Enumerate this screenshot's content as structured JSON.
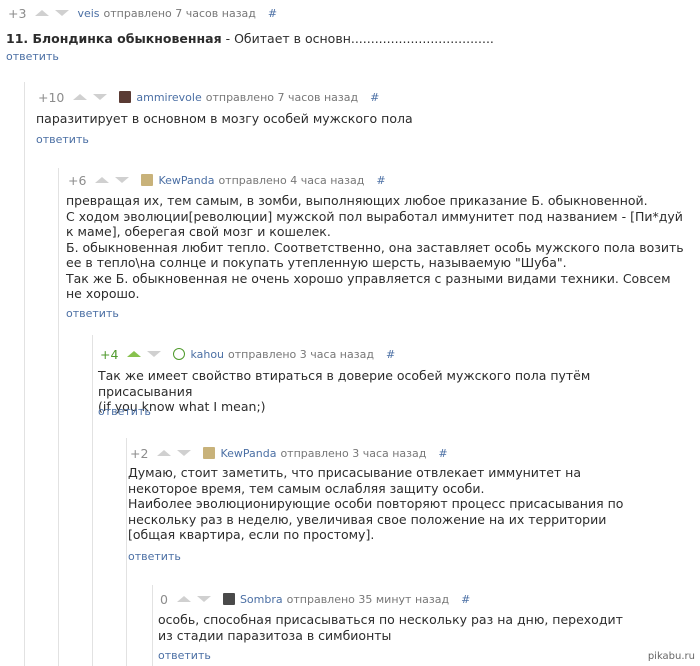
{
  "comments": [
    {
      "score": "+3",
      "author": "veis",
      "posted": "отправлено 7 часов назад",
      "hash": "#",
      "reply": "ответить",
      "text_bold": "11. Блондинка обыкновенная",
      "text_rest": " - Обитает в основн....................................",
      "avatar_color": "#ffffff"
    },
    {
      "score": "+10",
      "author": "ammirevole",
      "posted": "отправлено 7 часов назад",
      "hash": "#",
      "reply": "ответить",
      "text": "паразитирует в основном в мозгу особей мужского пола",
      "avatar_color": "#5a3b34"
    },
    {
      "score": "+6",
      "author": "KewPanda",
      "posted": "отправлено 4 часа назад",
      "hash": "#",
      "reply": "ответить",
      "lines": [
        "превращая их, тем самым, в зомби, выполняющих любое приказание Б. обыкновенной.",
        "С ходом эволюции[революции] мужской пол выработал иммунитет под названием - [Пи*дуй к маме], оберегая свой мозг и кошелек.",
        "Б. обыкновенная любит тепло. Соответственно, она заставляет особь мужского пола возить ее в тепло\\на солнце и покупать утепленную шерсть, называемую \"Шуба\".",
        "Так же Б. обыкновенная не очень хорошо управляется с разными видами техники. Совсем не хорошо."
      ],
      "avatar_color": "#c8b27a"
    },
    {
      "score": "+4",
      "author": "kahou",
      "posted": "отправлено 3 часа назад",
      "hash": "#",
      "reply": "ответить",
      "lines": [
        "Так же имеет свойство втираться в доверие особей мужского пола путём присасывания",
        "(if you know what I mean;)"
      ],
      "avatar_color": "#4f9a2c"
    },
    {
      "score": "+2",
      "author": "KewPanda",
      "posted": "отправлено 3 часа назад",
      "hash": "#",
      "reply": "ответить",
      "lines": [
        "Думаю, стоит заметить, что присасывание отвлекает иммунитет на некоторое время, тем самым ослабляя защиту особи.",
        "Наиболее эволюционирующие особи повторяют процесс присасывания по нескольку раз в неделю, увеличивая свое положение на их территории [общая квартира, если по простому]."
      ],
      "avatar_color": "#c8b27a"
    },
    {
      "score": "0",
      "author": "Sombra",
      "posted": "отправлено 35 минут назад",
      "hash": "#",
      "reply": "ответить",
      "lines": [
        "особь, способная присасываться по нескольку раз на дню, переходит из стадии паразитоза в симбионты"
      ],
      "avatar_color": "#4a4a4a"
    }
  ],
  "watermark": "pikabu.ru"
}
